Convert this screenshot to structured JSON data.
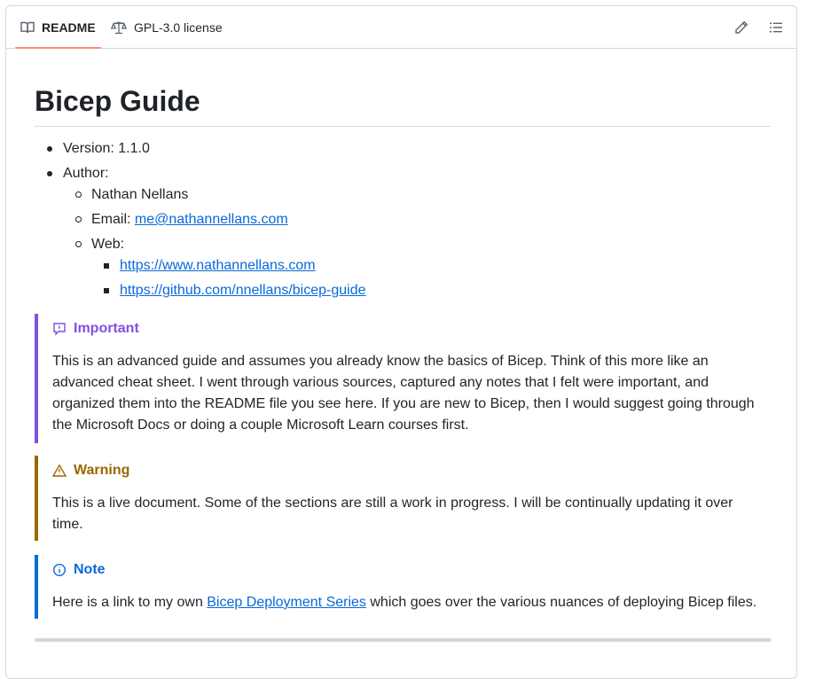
{
  "tabs": {
    "readme": "README",
    "license": "GPL-3.0 license"
  },
  "readme": {
    "title": "Bicep Guide",
    "version": "Version: 1.1.0",
    "author_label": "Author:",
    "author_name": "Nathan Nellans",
    "email_label": "Email: ",
    "email_link": "me@nathannellans.com",
    "web_label": "Web:",
    "web_links": [
      "https://www.nathannellans.com",
      "https://github.com/nnellans/bicep-guide"
    ]
  },
  "alerts": {
    "important": {
      "title": "Important",
      "color": "#8250df",
      "body": "This is an advanced guide and assumes you already know the basics of Bicep. Think of this more like an advanced cheat sheet. I went through various sources, captured any notes that I felt were important, and organized them into the README file you see here. If you are new to Bicep, then I would suggest going through the Microsoft Docs or doing a couple Microsoft Learn courses first."
    },
    "warning": {
      "title": "Warning",
      "color": "#9a6700",
      "body": "This is a live document. Some of the sections are still a work in progress. I will be continually updating it over time."
    },
    "note": {
      "title": "Note",
      "color": "#0969da",
      "body_before": "Here is a link to my own ",
      "link": "Bicep Deployment Series",
      "body_after": " which goes over the various nuances of deploying Bicep files."
    }
  },
  "icons": {
    "readme_tab": "book-icon",
    "license_tab": "law-scale-icon",
    "edit": "pencil-icon",
    "outline": "list-unordered-icon"
  }
}
